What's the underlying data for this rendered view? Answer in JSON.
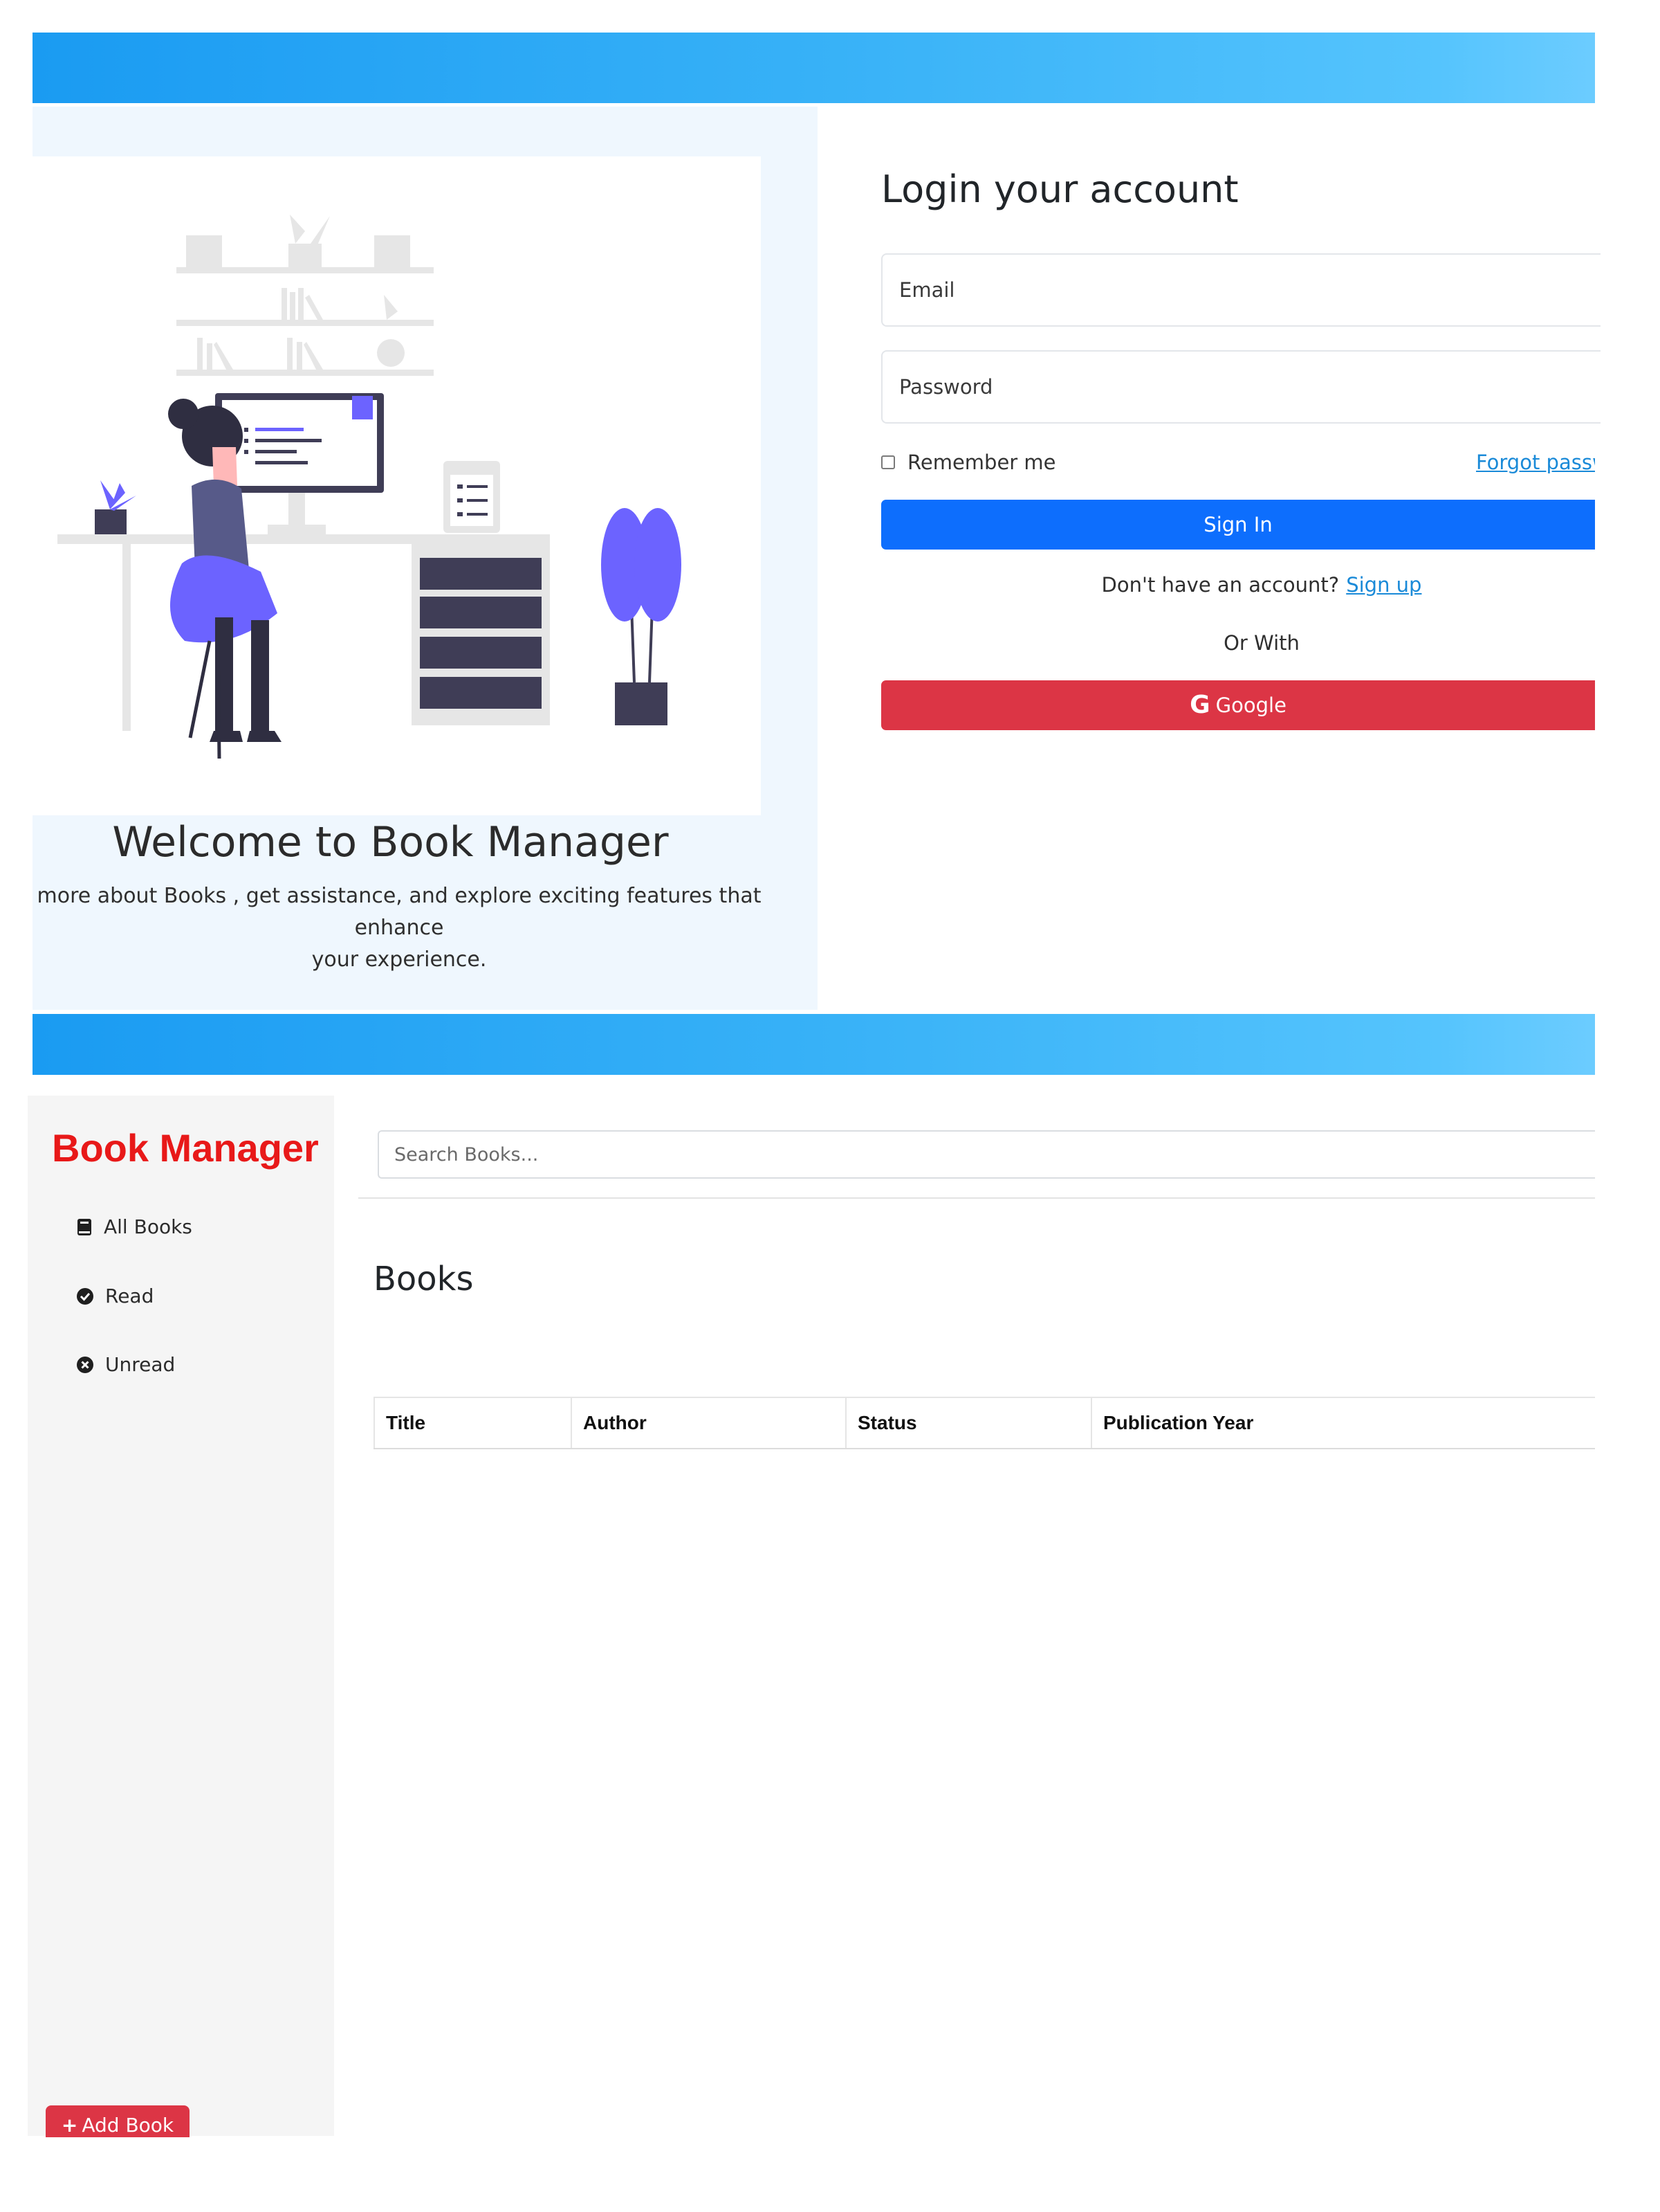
{
  "login": {
    "welcome_title": "Welcome to Book Manager",
    "welcome_text_line1": "more about Books , get assistance, and explore exciting features that enhance",
    "welcome_text_line2": "your experience.",
    "heading": "Login your account",
    "email_placeholder": "Email",
    "password_placeholder": "Password",
    "remember_label": "Remember me",
    "forgot_link": "Forgot password?",
    "signin_label": "Sign In",
    "signup_prompt": "Don't have an account?",
    "signup_link": "Sign up",
    "or_with": "Or With",
    "google_label": "Google",
    "google_icon": "google-g-icon"
  },
  "dashboard": {
    "brand": "Book Manager",
    "nav": [
      {
        "label": "All Books",
        "icon": "book-icon"
      },
      {
        "label": "Read",
        "icon": "check-circle-icon"
      },
      {
        "label": "Unread",
        "icon": "x-circle-icon"
      }
    ],
    "add_book_label": "Add Book",
    "search_placeholder": "Search Books...",
    "title": "Books",
    "table_headers": [
      "Title",
      "Author",
      "Status",
      "Publication Year"
    ]
  },
  "colors": {
    "header_gradient_start": "#1a9bf2",
    "header_gradient_end": "#6cccff",
    "primary": "#0d6efd",
    "danger": "#dc3545",
    "brand_red": "#e81919",
    "illustration_accent": "#6c63ff"
  }
}
